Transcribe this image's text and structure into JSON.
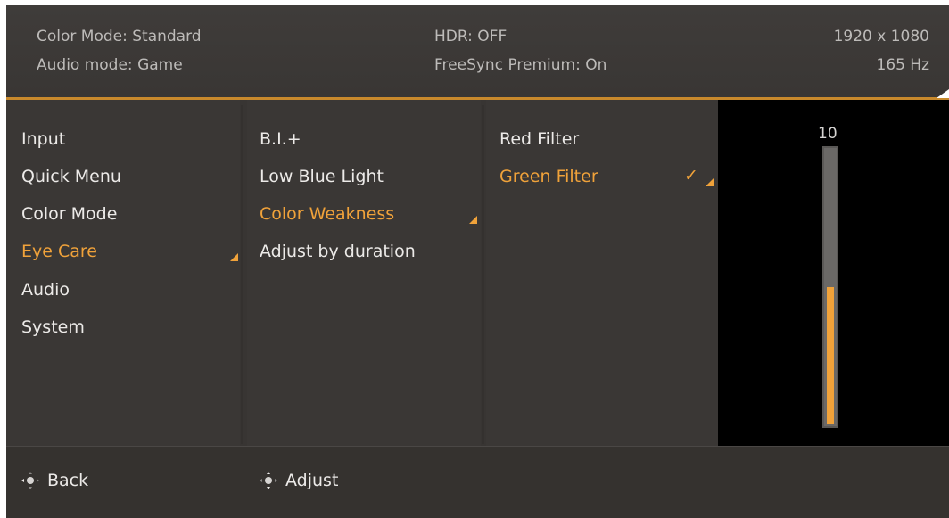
{
  "header": {
    "color_mode": "Color Mode: Standard",
    "audio_mode": "Audio mode: Game",
    "hdr": "HDR: OFF",
    "freesync": "FreeSync Premium: On",
    "resolution": "1920 x 1080",
    "refresh_rate": "165 Hz"
  },
  "menu": {
    "main": [
      "Input",
      "Quick Menu",
      "Color Mode",
      "Eye Care",
      "Audio",
      "System"
    ],
    "eye_care": [
      "B.I.+",
      "Low Blue Light",
      "Color Weakness",
      "Adjust by duration"
    ],
    "color_weakness": [
      "Red Filter",
      "Green Filter"
    ]
  },
  "selected": {
    "main": "Eye Care",
    "submenu": "Color Weakness",
    "option": "Green Filter"
  },
  "slider": {
    "value": "10",
    "level_fraction": 0.5
  },
  "footer": {
    "back_label": "Back",
    "adjust_label": "Adjust",
    "back_icon": "joystick-left-icon",
    "adjust_icon": "joystick-up-down-icon"
  },
  "colors": {
    "accent": "#f0a23a",
    "background": "#383533",
    "text": "#eceae8"
  }
}
